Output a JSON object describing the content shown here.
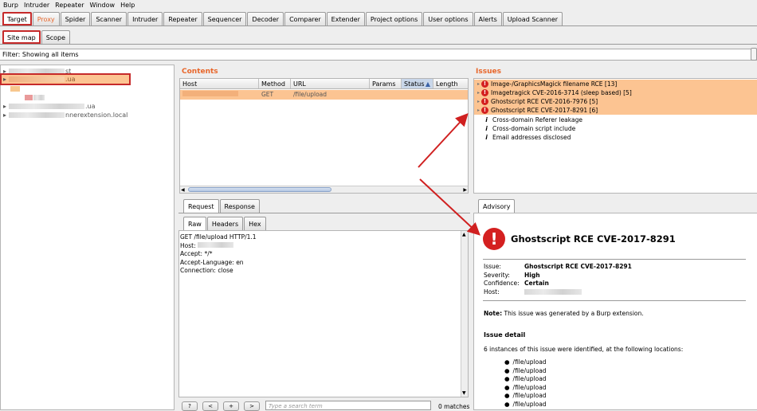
{
  "menu": [
    "Burp",
    "Intruder",
    "Repeater",
    "Window",
    "Help"
  ],
  "main_tabs": [
    "Target",
    "Proxy",
    "Spider",
    "Scanner",
    "Intruder",
    "Repeater",
    "Sequencer",
    "Decoder",
    "Comparer",
    "Extender",
    "Project options",
    "User options",
    "Alerts",
    "Upload Scanner"
  ],
  "sub_tabs": [
    "Site map",
    "Scope"
  ],
  "filter_text": "Filter: Showing all items",
  "tree": {
    "node1_suffix": "st",
    "node2_suffix": ".ua",
    "node3_suffix": ".ua",
    "node4_suffix": "nnerextension.local"
  },
  "contents": {
    "title": "Contents",
    "columns": [
      "Host",
      "Method",
      "URL",
      "Params",
      "Status",
      "Length"
    ],
    "sort_indicator": "▲",
    "row": {
      "method": "GET",
      "url": "/file/upload"
    }
  },
  "request_tabs": [
    "Request",
    "Response"
  ],
  "raw_tabs": [
    "Raw",
    "Headers",
    "Hex"
  ],
  "request_lines": {
    "line1": "GET /file/upload HTTP/1.1",
    "host_label": "Host:",
    "line3": "Accept: */*",
    "line4": "Accept-Language: en",
    "line5": "Connection: close"
  },
  "search": {
    "buttons": [
      "?",
      "<",
      "+",
      ">"
    ],
    "placeholder": "Type a search term",
    "matches": "0 matches"
  },
  "issues": {
    "title": "Issues",
    "high": [
      "Image-/GraphicsMagick filename RCE [13]",
      "Imagetragick CVE-2016-3714 (sleep based) [5]",
      "Ghostscript RCE CVE-2016-7976 [5]",
      "Ghostscript RCE CVE-2017-8291 [6]"
    ],
    "info": [
      "Cross-domain Referer leakage",
      "Cross-domain script include",
      "Email addresses disclosed"
    ]
  },
  "advisory": {
    "tab": "Advisory",
    "title": "Ghostscript RCE CVE-2017-8291",
    "fields": [
      {
        "label": "Issue:",
        "value": "Ghostscript RCE CVE-2017-8291"
      },
      {
        "label": "Severity:",
        "value": "High"
      },
      {
        "label": "Confidence:",
        "value": "Certain"
      },
      {
        "label": "Host:",
        "value": ""
      }
    ],
    "note_label": "Note:",
    "note_text": " This issue was generated by a Burp extension.",
    "detail_heading": "Issue detail",
    "detail_text": "6 instances of this issue were identified, at the following locations:",
    "locations": [
      "/file/upload",
      "/file/upload",
      "/file/upload",
      "/file/upload",
      "/file/upload",
      "/file/upload"
    ]
  },
  "colors": {
    "accent": "#e8662a",
    "highlight_row": "#fcc492",
    "annotation_red": "#d02020"
  }
}
